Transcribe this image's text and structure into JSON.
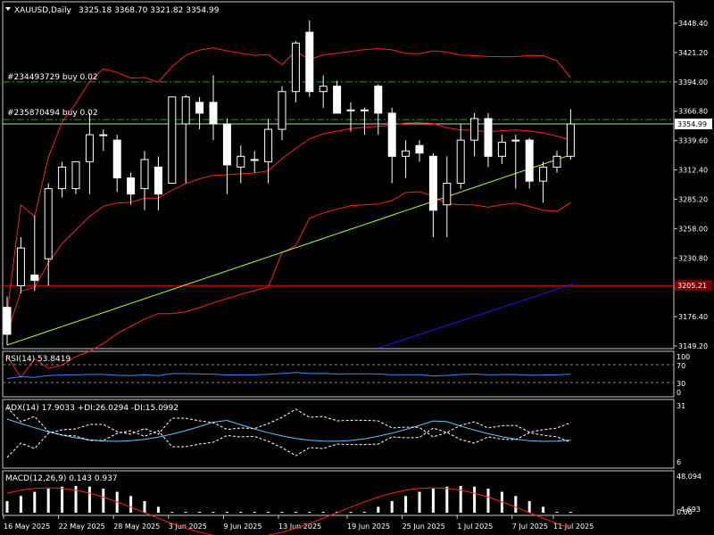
{
  "header": {
    "symbol_tf": "XAUUSD,Daily",
    "ohlc": "3325.18 3368.70 3321.82 3354.99"
  },
  "orders": [
    {
      "label": "#234493729 buy 0.02",
      "price": 3394.0
    },
    {
      "label": "#235870494 buy 0.02",
      "price": 3359.0
    }
  ],
  "colors": {
    "bollinger": "#ff2020",
    "ma": "#adff2f",
    "trendline": "#1a1aff",
    "hline": "#ff0000",
    "order_line": "#00b000",
    "rsi": "#3b8cff",
    "adx": "#5ec8ff",
    "di": "#ffffff",
    "macd_signal": "#ff2020",
    "macd_hist": "#ffffff"
  },
  "panels": {
    "rsi": {
      "title": "RSI(14) 53.8419",
      "levels": [
        "100",
        "70",
        "30",
        "0"
      ]
    },
    "adx": {
      "title": "ADX(14) 17.9033 +DI:26.0294 -DI:15.0992",
      "levels": [
        "31",
        "6"
      ]
    },
    "macd": {
      "title": "MACD(12,26,9) 0.143 0.937",
      "levels": [
        "48.094",
        "4.693",
        "0.00"
      ]
    }
  },
  "chart_data": {
    "type": "candlestick",
    "price_ticks": [
      "3448.40",
      "3421.20",
      "3394.00",
      "3366.80",
      "3339.60",
      "3312.40",
      "3285.20",
      "3258.00",
      "3230.80",
      "3203.60",
      "3176.40",
      "3149.20"
    ],
    "ylim": [
      3149.2,
      3448.4
    ],
    "current_price": "3354.99",
    "hline_label": "3205.21",
    "x_labels": [
      "16 May 2025",
      "22 May 2025",
      "28 May 2025",
      "3 Jun 2025",
      "9 Jun 2025",
      "13 Jun 2025",
      "19 Jun 2025",
      "25 Jun 2025",
      "1 Jul 2025",
      "7 Jul 2025",
      "11 Jul 2025"
    ],
    "candles": [
      {
        "o": 3185,
        "h": 3195,
        "l": 3150,
        "c": 3160
      },
      {
        "o": 3205,
        "h": 3250,
        "l": 3198,
        "c": 3240
      },
      {
        "o": 3215,
        "h": 3270,
        "l": 3200,
        "c": 3210
      },
      {
        "o": 3230,
        "h": 3300,
        "l": 3205,
        "c": 3295
      },
      {
        "o": 3295,
        "h": 3320,
        "l": 3287,
        "c": 3315
      },
      {
        "o": 3295,
        "h": 3320,
        "l": 3290,
        "c": 3320
      },
      {
        "o": 3320,
        "h": 3365,
        "l": 3290,
        "c": 3345
      },
      {
        "o": 3345,
        "h": 3350,
        "l": 3330,
        "c": 3345
      },
      {
        "o": 3340,
        "h": 3345,
        "l": 3292,
        "c": 3305
      },
      {
        "o": 3305,
        "h": 3310,
        "l": 3280,
        "c": 3290
      },
      {
        "o": 3295,
        "h": 3330,
        "l": 3275,
        "c": 3322
      },
      {
        "o": 3315,
        "h": 3325,
        "l": 3275,
        "c": 3290
      },
      {
        "o": 3300,
        "h": 3380,
        "l": 3300,
        "c": 3380
      },
      {
        "o": 3355,
        "h": 3382,
        "l": 3300,
        "c": 3380
      },
      {
        "o": 3375,
        "h": 3380,
        "l": 3350,
        "c": 3365
      },
      {
        "o": 3375,
        "h": 3400,
        "l": 3340,
        "c": 3355
      },
      {
        "o": 3355,
        "h": 3360,
        "l": 3290,
        "c": 3317
      },
      {
        "o": 3315,
        "h": 3335,
        "l": 3300,
        "c": 3325
      },
      {
        "o": 3322,
        "h": 3330,
        "l": 3310,
        "c": 3322
      },
      {
        "o": 3320,
        "h": 3360,
        "l": 3300,
        "c": 3350
      },
      {
        "o": 3350,
        "h": 3390,
        "l": 3340,
        "c": 3385
      },
      {
        "o": 3385,
        "h": 3432,
        "l": 3375,
        "c": 3430
      },
      {
        "o": 3440,
        "h": 3451,
        "l": 3380,
        "c": 3385
      },
      {
        "o": 3385,
        "h": 3400,
        "l": 3370,
        "c": 3390
      },
      {
        "o": 3390,
        "h": 3395,
        "l": 3365,
        "c": 3365
      },
      {
        "o": 3368,
        "h": 3375,
        "l": 3348,
        "c": 3368
      },
      {
        "o": 3368,
        "h": 3370,
        "l": 3345,
        "c": 3368
      },
      {
        "o": 3390,
        "h": 3392,
        "l": 3345,
        "c": 3365
      },
      {
        "o": 3365,
        "h": 3370,
        "l": 3300,
        "c": 3325
      },
      {
        "o": 3325,
        "h": 3340,
        "l": 3305,
        "c": 3330
      },
      {
        "o": 3335,
        "h": 3340,
        "l": 3320,
        "c": 3328
      },
      {
        "o": 3325,
        "h": 3328,
        "l": 3250,
        "c": 3275
      },
      {
        "o": 3280,
        "h": 3325,
        "l": 3250,
        "c": 3300
      },
      {
        "o": 3300,
        "h": 3355,
        "l": 3295,
        "c": 3340
      },
      {
        "o": 3340,
        "h": 3365,
        "l": 3325,
        "c": 3360
      },
      {
        "o": 3360,
        "h": 3365,
        "l": 3315,
        "c": 3325
      },
      {
        "o": 3325,
        "h": 3345,
        "l": 3318,
        "c": 3338
      },
      {
        "o": 3340,
        "h": 3345,
        "l": 3295,
        "c": 3340
      },
      {
        "o": 3340,
        "h": 3342,
        "l": 3295,
        "c": 3302
      },
      {
        "o": 3302,
        "h": 3320,
        "l": 3282,
        "c": 3315
      },
      {
        "o": 3315,
        "h": 3330,
        "l": 3310,
        "c": 3325
      },
      {
        "o": 3325,
        "h": 3368.7,
        "l": 3321.82,
        "c": 3354.99
      }
    ]
  }
}
